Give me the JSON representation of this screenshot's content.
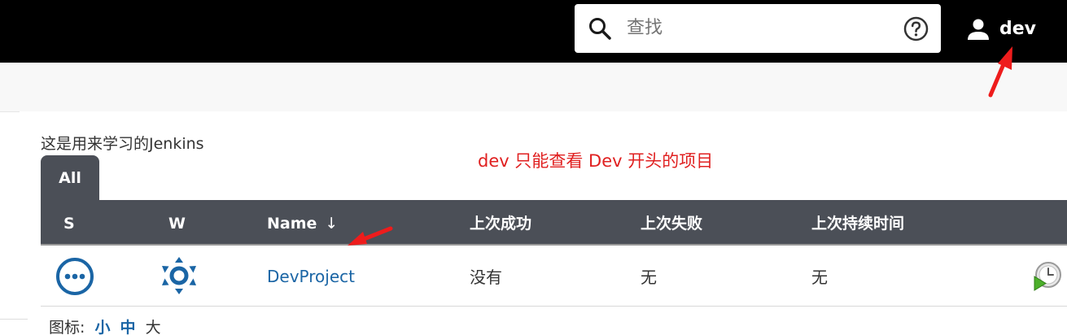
{
  "header": {
    "search_placeholder": "查找",
    "user_name": "dev"
  },
  "page": {
    "description": "这是用来学习的Jenkins",
    "annotation": "dev  只能查看 Dev 开头的项目"
  },
  "tabs": [
    {
      "label": "All",
      "active": true
    }
  ],
  "table": {
    "columns": {
      "status": "S",
      "weather": "W",
      "name": "Name",
      "sort_indicator": "↓",
      "last_success": "上次成功",
      "last_failure": "上次失败",
      "last_duration": "上次持续时间"
    },
    "rows": [
      {
        "status_icon": "status-not-built-icon",
        "weather_icon": "weather-sunny-icon",
        "name": "DevProject",
        "last_success": "没有",
        "last_failure": "无",
        "last_duration": "无",
        "action_icon": "schedule-build-icon"
      }
    ]
  },
  "icon_size": {
    "label": "图标:",
    "small": "小",
    "medium": "中",
    "large": "大"
  },
  "colors": {
    "header_bg": "#000000",
    "table_header_bg": "#4b4f57",
    "link": "#1a65a5",
    "annotation": "#e02020"
  }
}
